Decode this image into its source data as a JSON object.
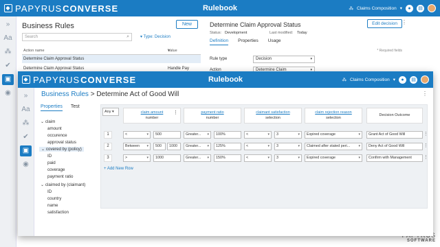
{
  "app": {
    "logo_prefix": "PAPYRUS",
    "logo_suffix": "CONVERSE",
    "title": "Rulebook",
    "workspace": "Claims Composition"
  },
  "back": {
    "panel_title": "Business Rules",
    "new_btn": "New",
    "search_placeholder": "Search",
    "type_filter": "Type: Decision",
    "col_action": "Action name",
    "col_value": "Value Stream",
    "rows": [
      {
        "name": "Determine Claim Approval Status",
        "stream": ""
      },
      {
        "name": "Determine Claim Approval Status",
        "stream": "Handle Pay Claim"
      }
    ],
    "detail_title": "Determine Claim Approval Status",
    "edit_btn": "Edit decision",
    "status_label": "Status:",
    "status_value": "Development",
    "modified_label": "Last modified:",
    "modified_value": "Today",
    "tabs": [
      "Definition",
      "Properties",
      "Usage"
    ],
    "required": "* Required fields",
    "rule_type_label": "Rule type",
    "rule_type_value": "Decision",
    "action_label": "Action",
    "action_value": "Determine Claim"
  },
  "front": {
    "breadcrumb_root": "Business Rules",
    "breadcrumb_sep": ">",
    "breadcrumb_page": "Determine Act of Good Will",
    "tabs": [
      "Properties",
      "Test"
    ],
    "tree": {
      "claim": "claim",
      "claim_children": [
        "amount",
        "occurence",
        "approval status"
      ],
      "policy": "covered by (policy)",
      "policy_children": [
        "ID",
        "paid",
        "coverage",
        "payment ratio"
      ],
      "claimant": "claimed by (claimant)",
      "claimant_children": [
        "ID",
        "country",
        "name",
        "satisfaction"
      ]
    },
    "any": "Any",
    "columns": [
      {
        "name": "claim amount",
        "type": "number"
      },
      {
        "name": "payment ratio",
        "type": "number"
      },
      {
        "name": "claimant satisfaction",
        "type": "selection"
      },
      {
        "name": "claim rejection reason",
        "type": "selection"
      },
      {
        "name": "Decision Outcome",
        "type": ""
      }
    ],
    "rows": [
      {
        "n": "1",
        "op": "<",
        "v1": "500",
        "v2": "",
        "ratio_op": "Greater...",
        "ratio": "100%",
        "sat_op": "<",
        "sat": "3",
        "reason": "Expired coverage",
        "outcome": "Grant Act of Good Will"
      },
      {
        "n": "2",
        "op": "Between",
        "v1": "500",
        "v2": "1000",
        "ratio_op": "Greater...",
        "ratio": "125%",
        "sat_op": "<",
        "sat": "3",
        "reason": "Claimed after stated peri...",
        "outcome": "Deny Act of Good Will"
      },
      {
        "n": "3",
        "op": ">",
        "v1": "1000",
        "v2": "",
        "ratio_op": "Greater...",
        "ratio": "150%",
        "sat_op": "<",
        "sat": "3",
        "reason": "Expired coverage",
        "outcome": "Confirm with Management"
      }
    ],
    "add_row": "+ Add New Row"
  },
  "brand": {
    "line1": "PAPYRUS",
    "line2": "SOFTWARE"
  }
}
